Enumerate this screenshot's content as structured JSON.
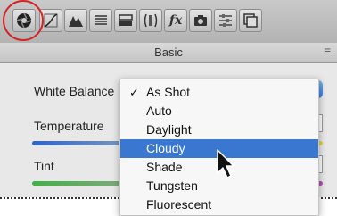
{
  "header": {
    "title": "Basic",
    "menu_icon": "list-icon"
  },
  "toolbar": {
    "icons": [
      "basic-panel-icon",
      "tone-curve-icon",
      "hsl-icon",
      "split-toning-icon",
      "detail-icon",
      "lens-corrections-icon",
      "fx-icon",
      "camera-calibration-icon",
      "presets-icon",
      "snapshots-icon"
    ],
    "fx_label": "fx"
  },
  "panel": {
    "white_balance_label": "White Balance",
    "temperature_label": "Temperature",
    "tint_label": "Tint"
  },
  "menu": {
    "checkmark": "✓",
    "items": [
      "As Shot",
      "Auto",
      "Daylight",
      "Cloudy",
      "Shade",
      "Tungsten",
      "Fluorescent"
    ],
    "selected_value": "As Shot",
    "highlighted_item": "Cloudy"
  },
  "colors": {
    "highlight": "#3a77d1",
    "annotation_circle": "#d42424"
  }
}
